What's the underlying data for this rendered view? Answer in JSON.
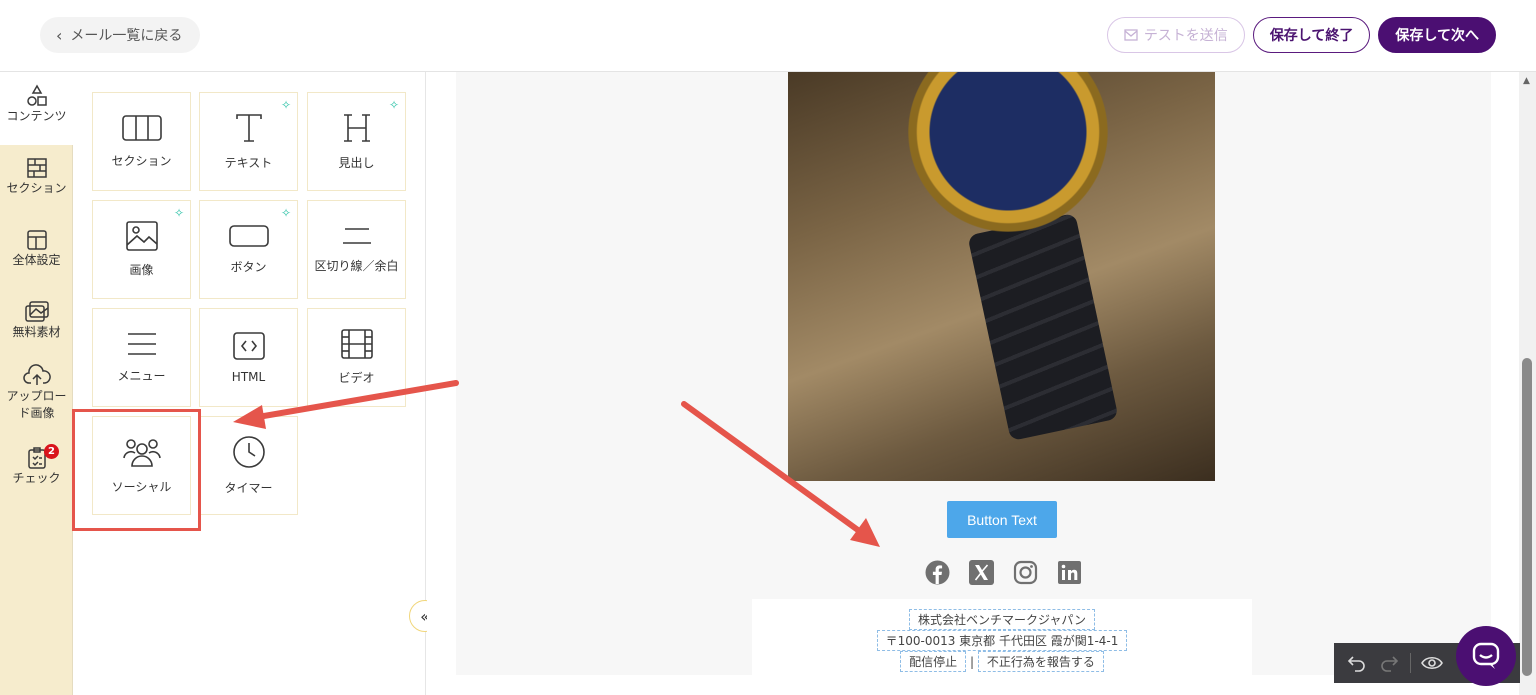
{
  "header": {
    "back_label": "メール一覧に戻る",
    "test_send_label": "テストを送信",
    "save_end_label": "保存して終了",
    "save_next_label": "保存して次へ"
  },
  "leftnav": {
    "items": [
      {
        "label": "コンテンツ",
        "icon": "shapes-icon"
      },
      {
        "label": "セクション",
        "icon": "bricks-icon"
      },
      {
        "label": "全体設定",
        "icon": "layout-icon"
      },
      {
        "label": "無料素材",
        "icon": "images-icon"
      },
      {
        "label": "アップロード画像",
        "label_line1": "アップロー",
        "label_line2": "ド画像",
        "icon": "cloud-upload-icon"
      },
      {
        "label": "チェック",
        "icon": "clipboard-check-icon",
        "badge": "2"
      }
    ]
  },
  "panel": {
    "tiles": [
      {
        "label": "セクション",
        "icon": "columns-icon"
      },
      {
        "label": "テキスト",
        "icon": "text-t-icon",
        "ai": true
      },
      {
        "label": "見出し",
        "icon": "heading-h-icon",
        "ai": true
      },
      {
        "label": "画像",
        "icon": "image-icon",
        "ai": true
      },
      {
        "label": "ボタン",
        "icon": "button-icon",
        "ai": true
      },
      {
        "label": "区切り線／余白",
        "icon": "divider-icon"
      },
      {
        "label": "メニュー",
        "icon": "menu-icon"
      },
      {
        "label": "HTML",
        "icon": "code-icon"
      },
      {
        "label": "ビデオ",
        "icon": "film-icon"
      },
      {
        "label": "ソーシャル",
        "icon": "people-icon"
      },
      {
        "label": "タイマー",
        "icon": "clock-icon"
      }
    ]
  },
  "email": {
    "button_text": "Button Text",
    "social_icons": [
      "facebook-icon",
      "x-icon",
      "instagram-icon",
      "linkedin-icon"
    ],
    "footer": {
      "company": "株式会社ベンチマークジャパン",
      "address": "〒100-0013 東京都 千代田区 霞が関1-4-1",
      "unsubscribe": "配信停止",
      "separator": "|",
      "report": "不正行為を報告する"
    }
  },
  "colors": {
    "brand_purple": "#4b0f72",
    "nav_bg": "#f6eccd",
    "email_button": "#4da7ea",
    "annotation_red": "#e5554b"
  }
}
